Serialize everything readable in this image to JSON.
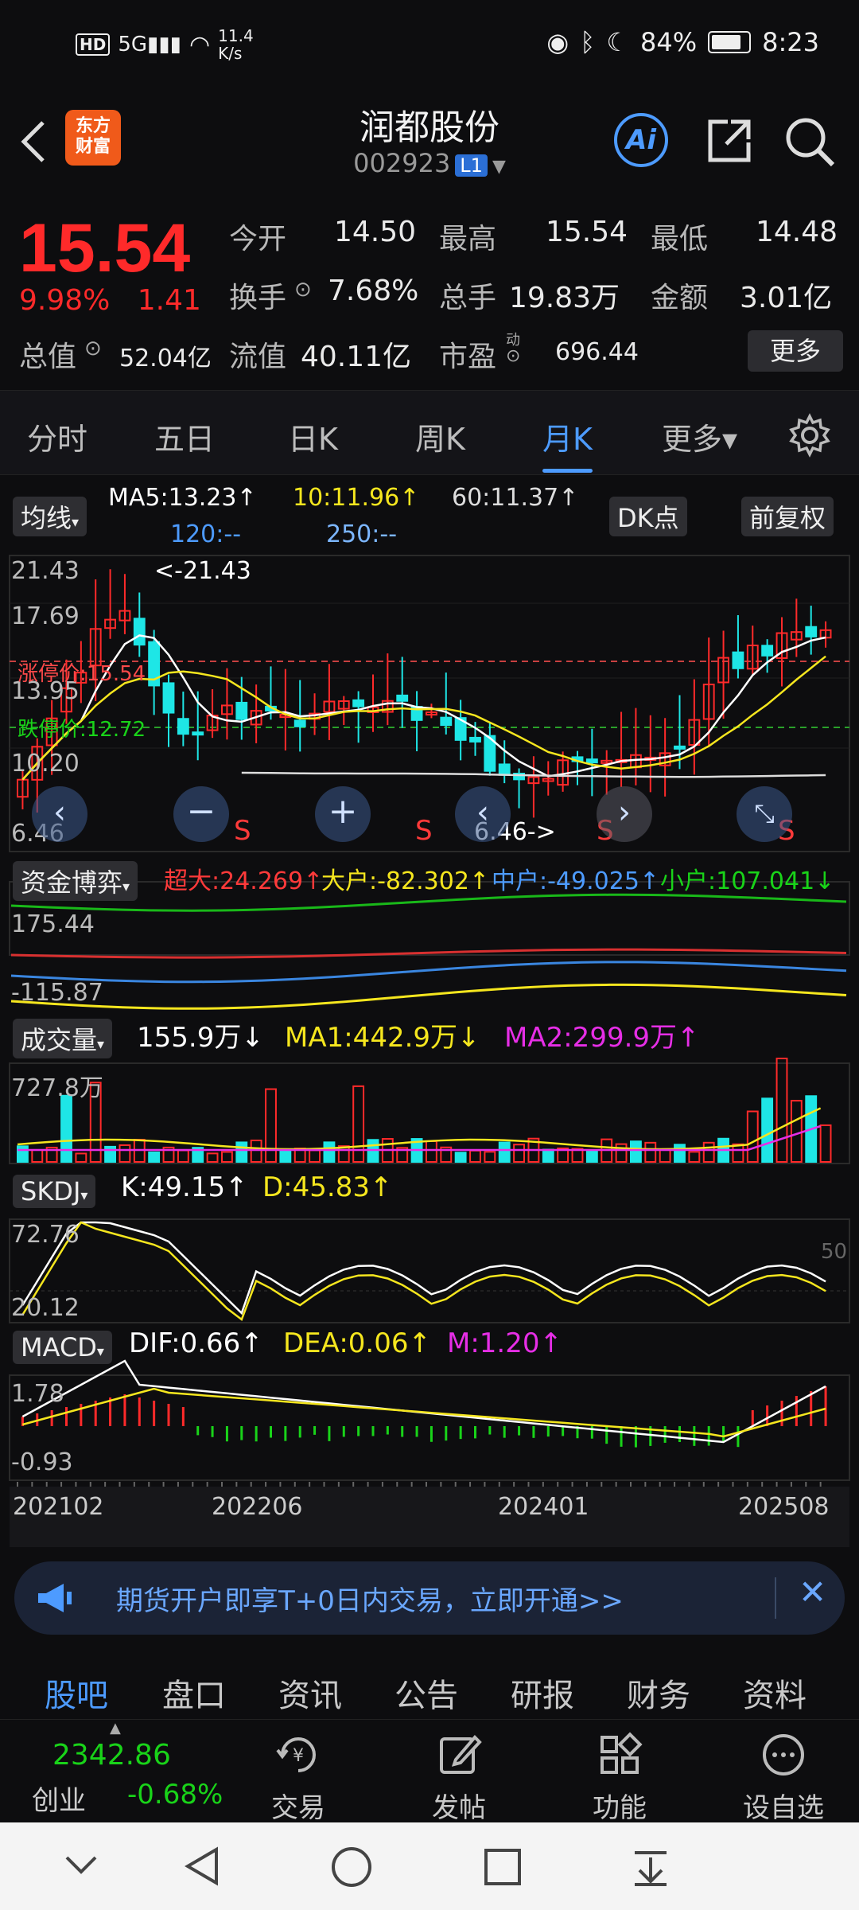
{
  "status": {
    "speed_top": "11.4",
    "speed_bottom": "K/s",
    "battery": "84%",
    "time": "8:23"
  },
  "header": {
    "title": "润都股份",
    "code": "002923",
    "level_badge": "L1",
    "logo_line1": "东方",
    "logo_line2": "财富"
  },
  "quote": {
    "price": "15.54",
    "pct": "9.98%",
    "change": "1.41",
    "open_label": "今开",
    "open": "14.50",
    "high_label": "最高",
    "high": "15.54",
    "low_label": "最低",
    "low": "14.48",
    "turnover_label": "换手",
    "turnover": "7.68%",
    "vol_label": "总手",
    "vol": "19.83万",
    "amount_label": "金额",
    "amount": "3.01亿",
    "mktcap_label": "总值",
    "mktcap": "52.04亿",
    "float_label": "流值",
    "float": "40.11亿",
    "pe_label": "市盈",
    "pe_sup": "动",
    "pe": "696.44",
    "more": "更多"
  },
  "tabs": [
    {
      "label": "分时"
    },
    {
      "label": "五日"
    },
    {
      "label": "日K"
    },
    {
      "label": "周K"
    },
    {
      "label": "月K"
    },
    {
      "label": "更多▾"
    }
  ],
  "ma": {
    "btn": "均线",
    "ma5": "MA5:13.23↑",
    "ma10": "10:11.96↑",
    "ma60": "60:11.37↑",
    "ma120": "120:--",
    "ma250": "250:--",
    "dk": "DK点",
    "fq": "前复权"
  },
  "kline": {
    "y_top": "21.43",
    "y2": "17.69",
    "y3": "13.95",
    "y4": "10.20",
    "y_bot": "6.46",
    "max_ann": "<-21.43",
    "min_ann": "6.46->",
    "limit_up": "涨停价:15.54",
    "limit_down": "跌停价:12.72",
    "s_mark": "S"
  },
  "fund": {
    "btn": "资金博弈",
    "big": "超大:24.269↑",
    "large": "大户:-82.302↑",
    "mid": "中户:-49.025↑",
    "small": "小户:107.041↓",
    "y_top": "175.44",
    "y_bot": "-115.87"
  },
  "volume": {
    "btn": "成交量",
    "cur": "155.9万↓",
    "ma1": "MA1:442.9万↓",
    "ma2": "MA2:299.9万↑",
    "y_top": "727.8万"
  },
  "skdj": {
    "btn": "SKDJ",
    "k": "K:49.15↑",
    "d": "D:45.83↑",
    "y_top": "72.76",
    "y_bot": "20.12",
    "ref": "50"
  },
  "macd": {
    "btn": "MACD",
    "dif": "DIF:0.66↑",
    "dea": "DEA:0.06↑",
    "m": "M:1.20↑",
    "y_top": "1.78",
    "y_bot": "-0.93"
  },
  "xaxis": [
    "202102",
    "202206",
    "202401",
    "202508"
  ],
  "banner": {
    "text": "期货开户即享T+0日内交易，立即开通>>"
  },
  "bottom_tabs": [
    {
      "label": "股吧"
    },
    {
      "label": "盘口"
    },
    {
      "label": "资讯"
    },
    {
      "label": "公告"
    },
    {
      "label": "研报"
    },
    {
      "label": "财务"
    },
    {
      "label": "资料"
    }
  ],
  "toolbar": {
    "index_value": "2342.86",
    "index_name": "创业",
    "index_change": "-0.68%",
    "trade": "交易",
    "post": "发帖",
    "func": "功能",
    "watch": "设自选"
  },
  "colors": {
    "up": "#ff2a2a",
    "down": "#19d319",
    "accent": "#4d9bff",
    "cyan": "#1ee6e6",
    "yellow": "#f5e61e",
    "magenta": "#e62ee6"
  }
}
